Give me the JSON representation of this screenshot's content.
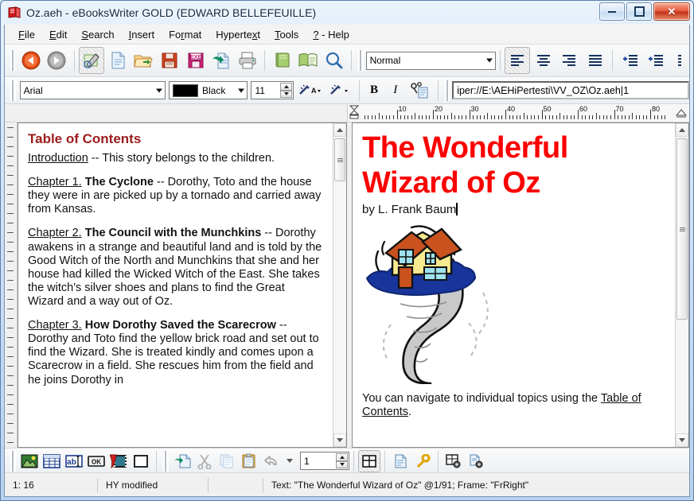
{
  "window": {
    "title": "Oz.aeh - eBooksWriter GOLD (EDWARD BELLEFEUILLE)",
    "app_icon": "red-book-icon",
    "minimize_label": "—",
    "restore_label": "❐",
    "close_label": "✕"
  },
  "menu": {
    "items": [
      {
        "label": "File",
        "accel": "F"
      },
      {
        "label": "Edit",
        "accel": "E"
      },
      {
        "label": "Search",
        "accel": "S"
      },
      {
        "label": "Insert",
        "accel": "I"
      },
      {
        "label": "Format",
        "accel": "r"
      },
      {
        "label": "Hypertext",
        "accel": "x"
      },
      {
        "label": "Tools",
        "accel": "T"
      },
      {
        "label": "? - Help",
        "accel": "?"
      }
    ]
  },
  "toolbar_main": {
    "buttons": [
      {
        "name": "back-button",
        "icon": "back-arrow-icon",
        "tip": "Back"
      },
      {
        "name": "forward-button",
        "icon": "forward-arrow-icon",
        "tip": "Forward"
      },
      {
        "name": "edit-mode-button",
        "icon": "pencil-edit-icon",
        "tip": "Edit"
      },
      {
        "name": "new-button",
        "icon": "new-document-icon",
        "tip": "New"
      },
      {
        "name": "open-button",
        "icon": "open-folder-icon",
        "tip": "Open"
      },
      {
        "name": "save-button",
        "icon": "floppy-save-icon",
        "tip": "Save"
      },
      {
        "name": "build-exe-button",
        "icon": "exe-floppy-icon",
        "tip": "Build EXE"
      },
      {
        "name": "export-button",
        "icon": "export-document-icon",
        "tip": "Export"
      },
      {
        "name": "print-button",
        "icon": "printer-icon",
        "tip": "Print"
      },
      {
        "name": "book-closed-button",
        "icon": "closed-book-icon",
        "tip": "Book"
      },
      {
        "name": "book-open-button",
        "icon": "open-book-icon",
        "tip": "Preview"
      },
      {
        "name": "zoom-button",
        "icon": "magnifier-icon",
        "tip": "Zoom"
      }
    ],
    "style_combo": {
      "value": "Normal",
      "name": "paragraph-style-combo"
    },
    "align_buttons": [
      {
        "name": "align-left-button",
        "icon": "align-left-icon",
        "active": true
      },
      {
        "name": "align-center-button",
        "icon": "align-center-icon",
        "active": false
      },
      {
        "name": "align-right-button",
        "icon": "align-right-icon",
        "active": false
      },
      {
        "name": "align-justify-button",
        "icon": "align-justify-icon",
        "active": false
      }
    ],
    "indent_buttons": [
      {
        "name": "indent-increase-button",
        "icon": "indent-increase-icon"
      },
      {
        "name": "indent-decrease-button",
        "icon": "indent-decrease-icon"
      }
    ]
  },
  "toolbar_format": {
    "font_combo": {
      "value": "Arial",
      "name": "font-family-combo"
    },
    "color_combo": {
      "value": "Black",
      "swatch": "#000000",
      "name": "font-color-combo"
    },
    "size_spinner": {
      "value": "11",
      "name": "font-size-spinner"
    },
    "highlight_button": {
      "name": "text-effects-button",
      "icon": "magic-wand-a-icon"
    },
    "effects_button": {
      "name": "magic-wand-button",
      "icon": "magic-wand-icon"
    },
    "bold_button": {
      "label": "B",
      "name": "bold-button"
    },
    "italic_button": {
      "label": "I",
      "name": "italic-button"
    },
    "link_button": {
      "name": "hyperlink-button",
      "icon": "chain-link-icon"
    },
    "address_field": {
      "value": "iper://E:\\AEHiPertesti\\VV_OZ\\Oz.aeh|1",
      "name": "hyperlink-address-field"
    }
  },
  "ruler": {
    "numbers": [
      "10",
      "20",
      "30",
      "40",
      "50",
      "60",
      "70",
      "80"
    ],
    "left_indent_marker": "indent-marker",
    "right_indent_marker": "right-indent-marker"
  },
  "left_pane": {
    "heading": "Table of Contents",
    "entries": [
      {
        "link": "Introduction",
        "title": "",
        "text": " -- This story belongs to the children."
      },
      {
        "link": "Chapter 1.",
        "title": "The Cyclone",
        "text": " -- Dorothy, Toto and the house they were in are picked up by a tornado and carried away from Kansas."
      },
      {
        "link": "Chapter 2.",
        "title": "The Council with the Munchkins",
        "text": " -- Dorothy awakens in a strange and beautiful land and is told by the Good Witch of the North and Munchkins that she and her house had killed the Wicked Witch of the East. She takes the witch's silver shoes and plans to find the Great Wizard and a way out of Oz."
      },
      {
        "link": "Chapter 3.",
        "title": "How Dorothy Saved the Scarecrow",
        "text": " -- Dorothy and Toto find the yellow brick road and set out to find the Wizard. She is treated kindly and comes upon a Scarecrow in a field. She rescues him from the field and he joins Dorothy in"
      }
    ]
  },
  "right_pane": {
    "title_line1": "The Wonderful",
    "title_line2": "Wizard of Oz",
    "title_color": "#fc0000",
    "byline": "by L. Frank Baum",
    "illustration": "house-on-tornado-icon",
    "nav_text_before": "You can navigate to individual topics using the ",
    "nav_link": "Table of Contents",
    "nav_text_after": "."
  },
  "toolbar_bottom": {
    "insert_buttons": [
      {
        "name": "insert-image-button",
        "icon": "picture-icon"
      },
      {
        "name": "insert-table-button",
        "icon": "table-icon"
      },
      {
        "name": "insert-textbox-button",
        "icon": "abc-textbox-icon"
      },
      {
        "name": "insert-button-button",
        "icon": "ok-button-icon"
      },
      {
        "name": "insert-multimedia-button",
        "icon": "film-strip-icon"
      },
      {
        "name": "insert-frame-button",
        "icon": "empty-frame-icon"
      }
    ],
    "edit_buttons": [
      {
        "name": "goto-link-button",
        "icon": "export-document-icon"
      },
      {
        "name": "cut-button",
        "icon": "scissors-icon"
      },
      {
        "name": "copy-button",
        "icon": "copy-pages-icon"
      },
      {
        "name": "paste-button",
        "icon": "clipboard-paste-icon"
      },
      {
        "name": "undo-button",
        "icon": "undo-arrow-icon"
      }
    ],
    "undo-dropdown": {
      "name": "undo-dropdown-button",
      "icon": "chevron-down-icon"
    },
    "page_spinner": {
      "value": "1",
      "name": "page-number-spinner"
    },
    "view_buttons": [
      {
        "name": "frames-view-button",
        "icon": "frames-grid-icon",
        "active": true
      },
      {
        "name": "page-properties-button",
        "icon": "document-icon"
      },
      {
        "name": "protection-button",
        "icon": "key-icon"
      },
      {
        "name": "frame-settings-button",
        "icon": "frame-gear-icon"
      },
      {
        "name": "page-settings-button",
        "icon": "document-gear-icon"
      }
    ]
  },
  "status_bar": {
    "position": "1: 16",
    "state": "HY modified",
    "info": "Text: \"The Wonderful Wizard of Oz\" @1/91; Frame: \"FrRight\""
  }
}
